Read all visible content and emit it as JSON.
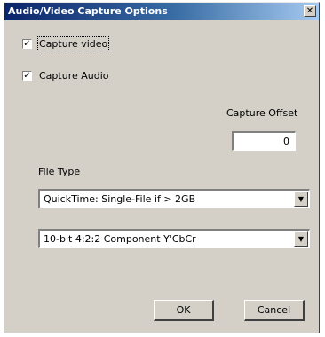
{
  "dialog": {
    "title": "Audio/Video Capture Options",
    "close_glyph": "✕"
  },
  "options": {
    "capture_video": {
      "label": "Capture video",
      "checked": true,
      "glyph": "✓"
    },
    "capture_audio": {
      "label": "Capture Audio",
      "checked": true,
      "glyph": "✓"
    }
  },
  "capture_offset": {
    "label": "Capture Offset",
    "value": "0"
  },
  "file_type": {
    "label": "File Type",
    "format_value": "QuickTime: Single-File if > 2GB",
    "codec_value": "10-bit 4:2:2 Component Y'CbCr",
    "arrow_glyph": "▼"
  },
  "buttons": {
    "ok": "OK",
    "cancel": "Cancel"
  },
  "colors": {
    "titlebar_start": "#0a246a",
    "titlebar_end": "#a6caf0",
    "face": "#d4d0c8"
  }
}
